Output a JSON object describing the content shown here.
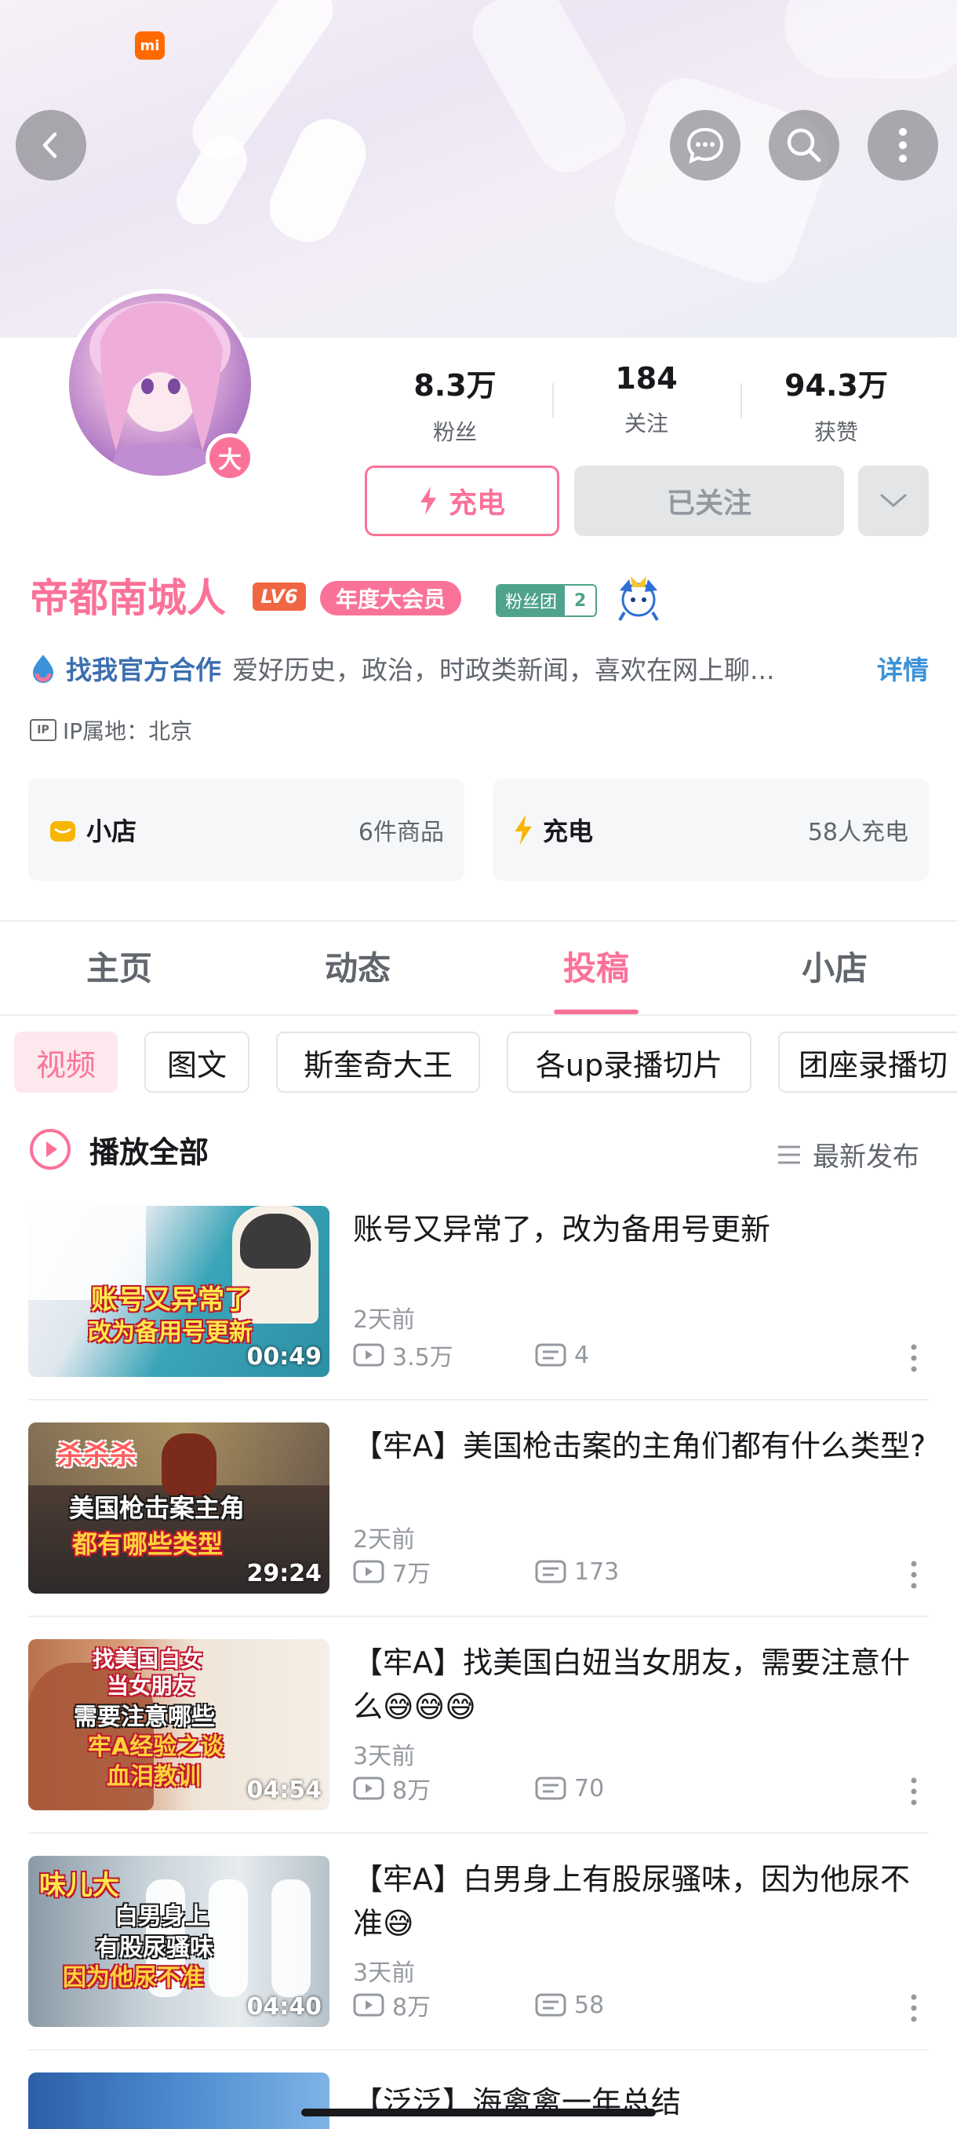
{
  "status_bar": {
    "brand": "mi"
  },
  "top_icons": [
    "back-icon",
    "chat-icon",
    "search-icon",
    "more-vertical-icon"
  ],
  "avatar_badge": "大",
  "stats": [
    {
      "value": "8.3万",
      "label": "粉丝"
    },
    {
      "value": "184",
      "label": "关注"
    },
    {
      "value": "94.3万",
      "label": "获赞"
    }
  ],
  "buttons": {
    "charge": "充电",
    "followed": "已关注"
  },
  "profile": {
    "name": "帝都南城人",
    "level": "LV6",
    "vip": "年度大会员",
    "fan_club": {
      "label": "粉丝团",
      "level": "2"
    },
    "bio_link": "找我官方合作",
    "bio": "爱好历史，政治，时政类新闻，喜欢在网上聊...",
    "bio_more": "详情",
    "ip_tag": "IP",
    "ip": "IP属地：北京"
  },
  "cards": [
    {
      "title": "小店",
      "sub": "6件商品"
    },
    {
      "title": "充电",
      "sub": "58人充电"
    }
  ],
  "tabs": [
    "主页",
    "动态",
    "投稿",
    "小店"
  ],
  "active_tab": "投稿",
  "chips": [
    "视频",
    "图文",
    "斯奎奇大王",
    "各up录播切片",
    "团座录播切"
  ],
  "play_all": "播放全部",
  "sort": "最新发布",
  "videos": [
    {
      "title": "账号又异常了，改为备用号更新",
      "date": "2天前",
      "views": "3.5万",
      "comments": "4",
      "duration": "00:49",
      "caption1": "账号又异常了",
      "caption2": "改为备用号更新"
    },
    {
      "title": "【牢A】美国枪击案的主角们都有什么类型?",
      "date": "2天前",
      "views": "7万",
      "comments": "173",
      "duration": "29:24",
      "caption1": "杀杀杀",
      "caption2": "美国枪击案主角",
      "caption3": "都有哪些类型"
    },
    {
      "title": "【牢A】找美国白妞当女朋友，需要注意什么😅😅😅",
      "date": "3天前",
      "views": "8万",
      "comments": "70",
      "duration": "04:54",
      "caption1": "找美国白女",
      "caption2": "当女朋友",
      "caption3": "需要注意哪些",
      "caption4": "牢A经验之谈",
      "caption5": "血泪教训"
    },
    {
      "title": "【牢A】白男身上有股尿骚味，因为他尿不准😅",
      "date": "3天前",
      "views": "8万",
      "comments": "58",
      "duration": "04:40",
      "caption1": "味儿大",
      "caption2": "白男身上",
      "caption3": "有股尿骚味",
      "caption4": "因为他尿不准"
    }
  ],
  "partial_next_title": "【泛泛】海禽禽一年总结",
  "colors": {
    "accent": "#fb7299",
    "text": "#18191c",
    "muted": "#9499a0",
    "link_blue": "#3b92d8"
  }
}
